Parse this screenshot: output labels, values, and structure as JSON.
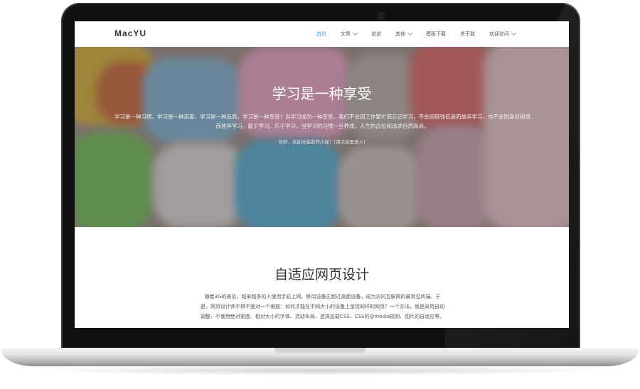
{
  "site": {
    "logo": "MacYU"
  },
  "nav": [
    {
      "label": "首页",
      "active": true,
      "dropdown": false
    },
    {
      "label": "文章",
      "active": false,
      "dropdown": true
    },
    {
      "label": "说说",
      "active": false,
      "dropdown": false
    },
    {
      "label": "其他",
      "active": false,
      "dropdown": true
    },
    {
      "label": "模板下载",
      "active": false,
      "dropdown": false
    },
    {
      "label": "关于我",
      "active": false,
      "dropdown": false
    },
    {
      "label": "欢迎访问",
      "active": false,
      "dropdown": true
    }
  ],
  "hero": {
    "title": "学习是一种享受",
    "text": "学习是一种习惯，学习是一种态度，学习是一种品质，学习是一种享受！当学习成为一种享受，我们不会因工作繁忙而忘记学习，不会因借钱低迷而放弃学习，也不会因身处困境而放弃学习。勤于学习、乐于学习，当学习的习惯一旦养成，人生的品位和追求自然高尚。",
    "link": "你好，欢迎光临我的小屋！[请点这里进入]"
  },
  "section": {
    "title": "自适应网页设计",
    "text": "随着3G的普及，越来越多的人使用手机上网。移动设备正超过桌面设备，成为访问互联网的最常见终端。于是，网页设计师不得不面对一个难题：如何才能在不同大小的设备上呈现同样的网页？一个办法，就是采用自动调整，不使用绝对宽度、相对大小的字体、流动布局、选择加载CSS、CSS的@media规则、图片的自适应等。"
  },
  "colors": {
    "accent": "#3aa0e0",
    "text_dark": "#333333",
    "laptop_bezel": "#111111"
  }
}
